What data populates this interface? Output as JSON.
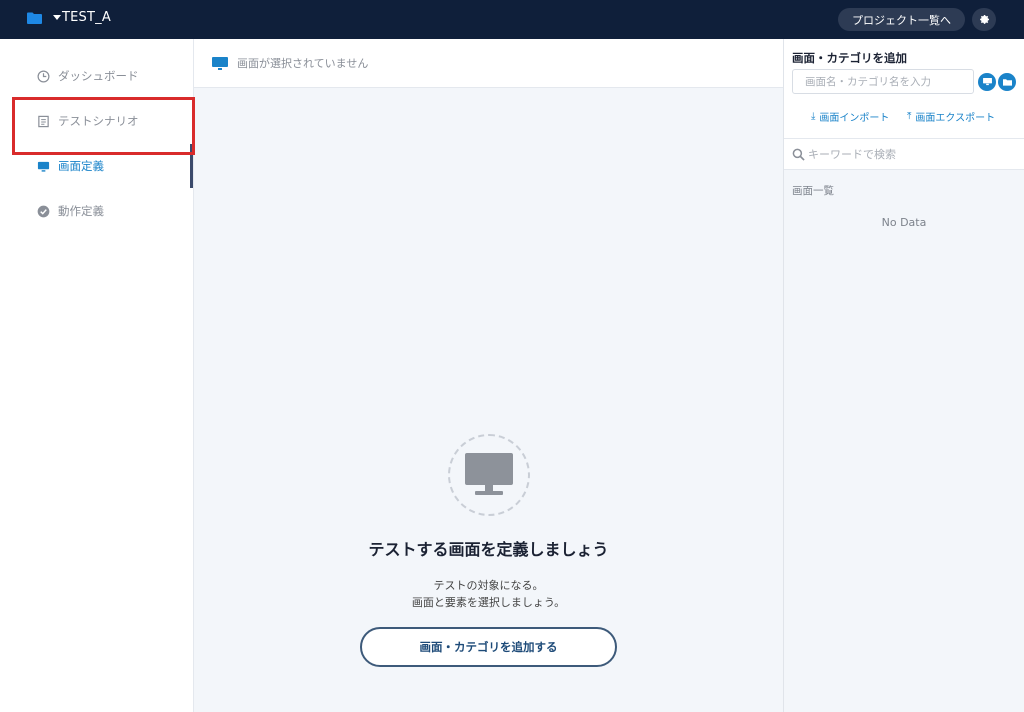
{
  "topbar": {
    "project_name": "TEST_A",
    "projects_button": "プロジェクト一覧へ",
    "folder_icon": "folder-icon",
    "settings_icon": "gear-icon"
  },
  "sidebar": {
    "items": [
      {
        "label": "ダッシュボード",
        "icon": "clock-icon",
        "active": false
      },
      {
        "label": "テストシナリオ",
        "icon": "document-icon",
        "active": false
      },
      {
        "label": "画面定義",
        "icon": "monitor-icon",
        "active": true
      },
      {
        "label": "動作定義",
        "icon": "check-circle-icon",
        "active": false
      }
    ]
  },
  "main": {
    "header_label": "画面が選択されていません",
    "empty_title": "テストする画面を定義しましょう",
    "empty_desc_line1": "テストの対象になる。",
    "empty_desc_line2": "画面と要素を選択しましょう。",
    "add_button": "画面・カテゴリを追加する"
  },
  "right_panel": {
    "title": "画面・カテゴリを追加",
    "input_placeholder": "画面名・カテゴリ名を入力",
    "import_link": "画面インポート",
    "export_link": "画面エクスポート",
    "search_placeholder": "キーワードで検索",
    "list_title": "画面一覧",
    "no_data": "No Data"
  },
  "colors": {
    "topbar": "#0f1f3a",
    "accent": "#1a83c9",
    "highlight": "#d92b2b"
  }
}
